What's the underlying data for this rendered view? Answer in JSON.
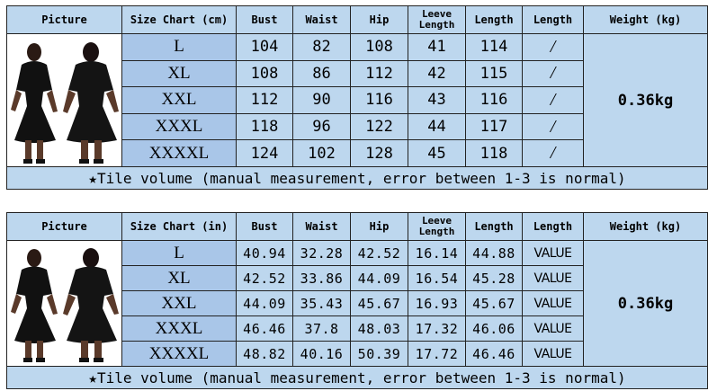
{
  "tables": [
    {
      "headers": {
        "picture": "Picture",
        "size_chart": "Size Chart (cm)",
        "bust": "Bust",
        "waist": "Waist",
        "hip": "Hip",
        "sleeve": "Leeve Length",
        "length": "Length",
        "length2": "Length",
        "weight": "Weight (kg)"
      },
      "rows": [
        {
          "size": "L",
          "bust": "104",
          "waist": "82",
          "hip": "108",
          "sleeve": "41",
          "length": "114",
          "extra": "/"
        },
        {
          "size": "XL",
          "bust": "108",
          "waist": "86",
          "hip": "112",
          "sleeve": "42",
          "length": "115",
          "extra": "/"
        },
        {
          "size": "XXL",
          "bust": "112",
          "waist": "90",
          "hip": "116",
          "sleeve": "43",
          "length": "116",
          "extra": "/"
        },
        {
          "size": "XXXL",
          "bust": "118",
          "waist": "96",
          "hip": "122",
          "sleeve": "44",
          "length": "117",
          "extra": "/"
        },
        {
          "size": "XXXXL",
          "bust": "124",
          "waist": "102",
          "hip": "128",
          "sleeve": "45",
          "length": "118",
          "extra": "/"
        }
      ],
      "weight": "0.36kg",
      "note": "★Tile volume (manual measurement, error between 1-3 is normal)"
    },
    {
      "headers": {
        "picture": "Picture",
        "size_chart": "Size Chart (in)",
        "bust": "Bust",
        "waist": "Waist",
        "hip": "Hip",
        "sleeve": "Leeve Length",
        "length": "Length",
        "length2": "Length",
        "weight": "Weight (kg)"
      },
      "rows": [
        {
          "size": "L",
          "bust": "40.94",
          "waist": "32.28",
          "hip": "42.52",
          "sleeve": "16.14",
          "length": "44.88",
          "extra": "VALUE"
        },
        {
          "size": "XL",
          "bust": "42.52",
          "waist": "33.86",
          "hip": "44.09",
          "sleeve": "16.54",
          "length": "45.28",
          "extra": "VALUE"
        },
        {
          "size": "XXL",
          "bust": "44.09",
          "waist": "35.43",
          "hip": "45.67",
          "sleeve": "16.93",
          "length": "45.67",
          "extra": "VALUE"
        },
        {
          "size": "XXXL",
          "bust": "46.46",
          "waist": "37.8",
          "hip": "48.03",
          "sleeve": "17.32",
          "length": "46.06",
          "extra": "VALUE"
        },
        {
          "size": "XXXXL",
          "bust": "48.82",
          "waist": "40.16",
          "hip": "50.39",
          "sleeve": "17.72",
          "length": "46.46",
          "extra": "VALUE"
        }
      ],
      "weight": "0.36kg",
      "note": "★Tile volume (manual measurement, error between 1-3 is normal)"
    }
  ],
  "colors": {
    "cell": "#bdd7ee",
    "size_cell": "#a9c6e8",
    "border": "#222222",
    "dress": "#111111"
  },
  "icons": [
    "dress-photo"
  ]
}
